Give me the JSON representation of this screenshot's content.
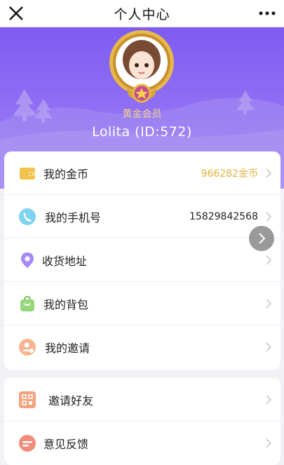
{
  "nav": {
    "title": "个人中心",
    "close_icon": "close-icon",
    "more_icon": "more-dots-icon"
  },
  "profile": {
    "level": "黄金会员",
    "username": "Lolita (ID:572)",
    "colors": {
      "header": "#7e5cf2",
      "level": "#f1d48a"
    }
  },
  "menu_main": [
    {
      "label": "我的金币",
      "value": "966282金币",
      "icon": "wallet-icon",
      "color": "#f2c34b"
    },
    {
      "label": "我的手机号",
      "value": "15829842568",
      "icon": "phone-icon",
      "color": "#58c6e8"
    },
    {
      "label": "收货地址",
      "value": "",
      "icon": "location-pin-icon",
      "color": "#9b7cf2"
    },
    {
      "label": "我的背包",
      "value": "",
      "icon": "bag-icon",
      "color": "#8fd26e"
    },
    {
      "label": "我的邀请",
      "value": "",
      "icon": "invite-user-icon",
      "color": "#f2a07b"
    }
  ],
  "menu_secondary": [
    {
      "label": "邀请好友",
      "icon": "qrcode-icon",
      "color": "#f2a07b"
    },
    {
      "label": "意见反馈",
      "icon": "feedback-icon",
      "color": "#f07a6a"
    }
  ]
}
